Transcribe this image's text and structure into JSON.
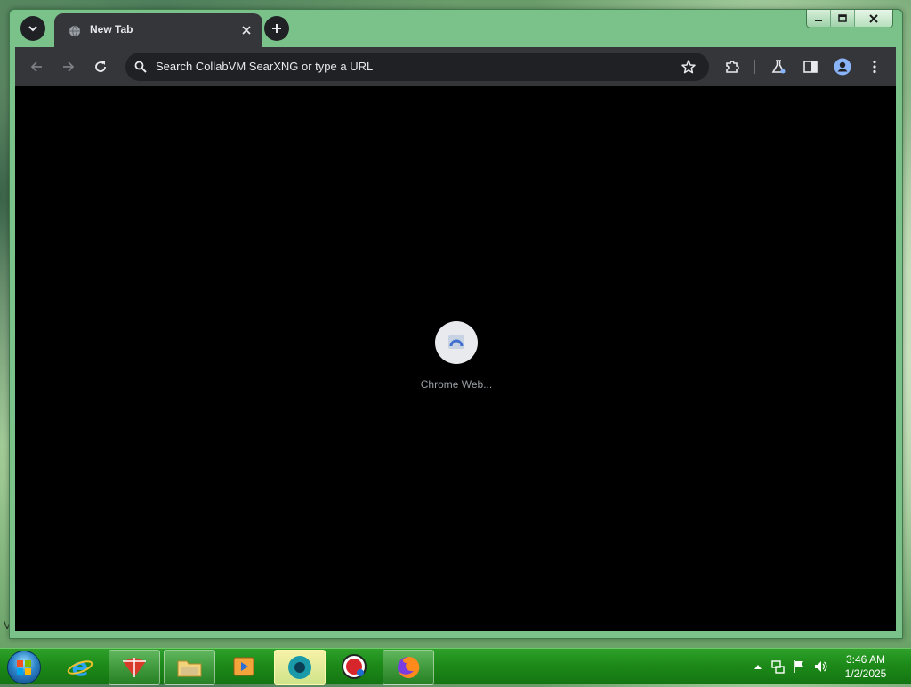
{
  "desktop": {
    "corner_text": "V"
  },
  "browser": {
    "tab": {
      "title": "New Tab"
    },
    "omnibox": {
      "placeholder": "Search CollabVM SearXNG or type a URL"
    },
    "content": {
      "center_label": "Chrome Web..."
    }
  },
  "icons": {
    "tab_menu": "chevron-down-icon",
    "tab_favicon": "globe-icon",
    "tab_close": "close-icon",
    "new_tab": "plus-icon",
    "back": "arrow-left-icon",
    "forward": "arrow-right-icon",
    "reload": "reload-icon",
    "search": "search-icon",
    "bookmark": "star-icon",
    "extensions": "puzzle-icon",
    "labs": "flask-icon",
    "side_panel": "side-panel-icon",
    "profile": "avatar-icon",
    "menu": "kebab-menu-icon"
  },
  "taskbar": {
    "clock_time": "3:46 AM",
    "clock_date": "1/2/2025"
  },
  "colors": {
    "browser_dark": "#35363a",
    "omnibox_bg": "#202124",
    "content_bg": "#000000",
    "taskbar_green": "#1d8a19",
    "accent_blue": "#8ab4f8"
  }
}
